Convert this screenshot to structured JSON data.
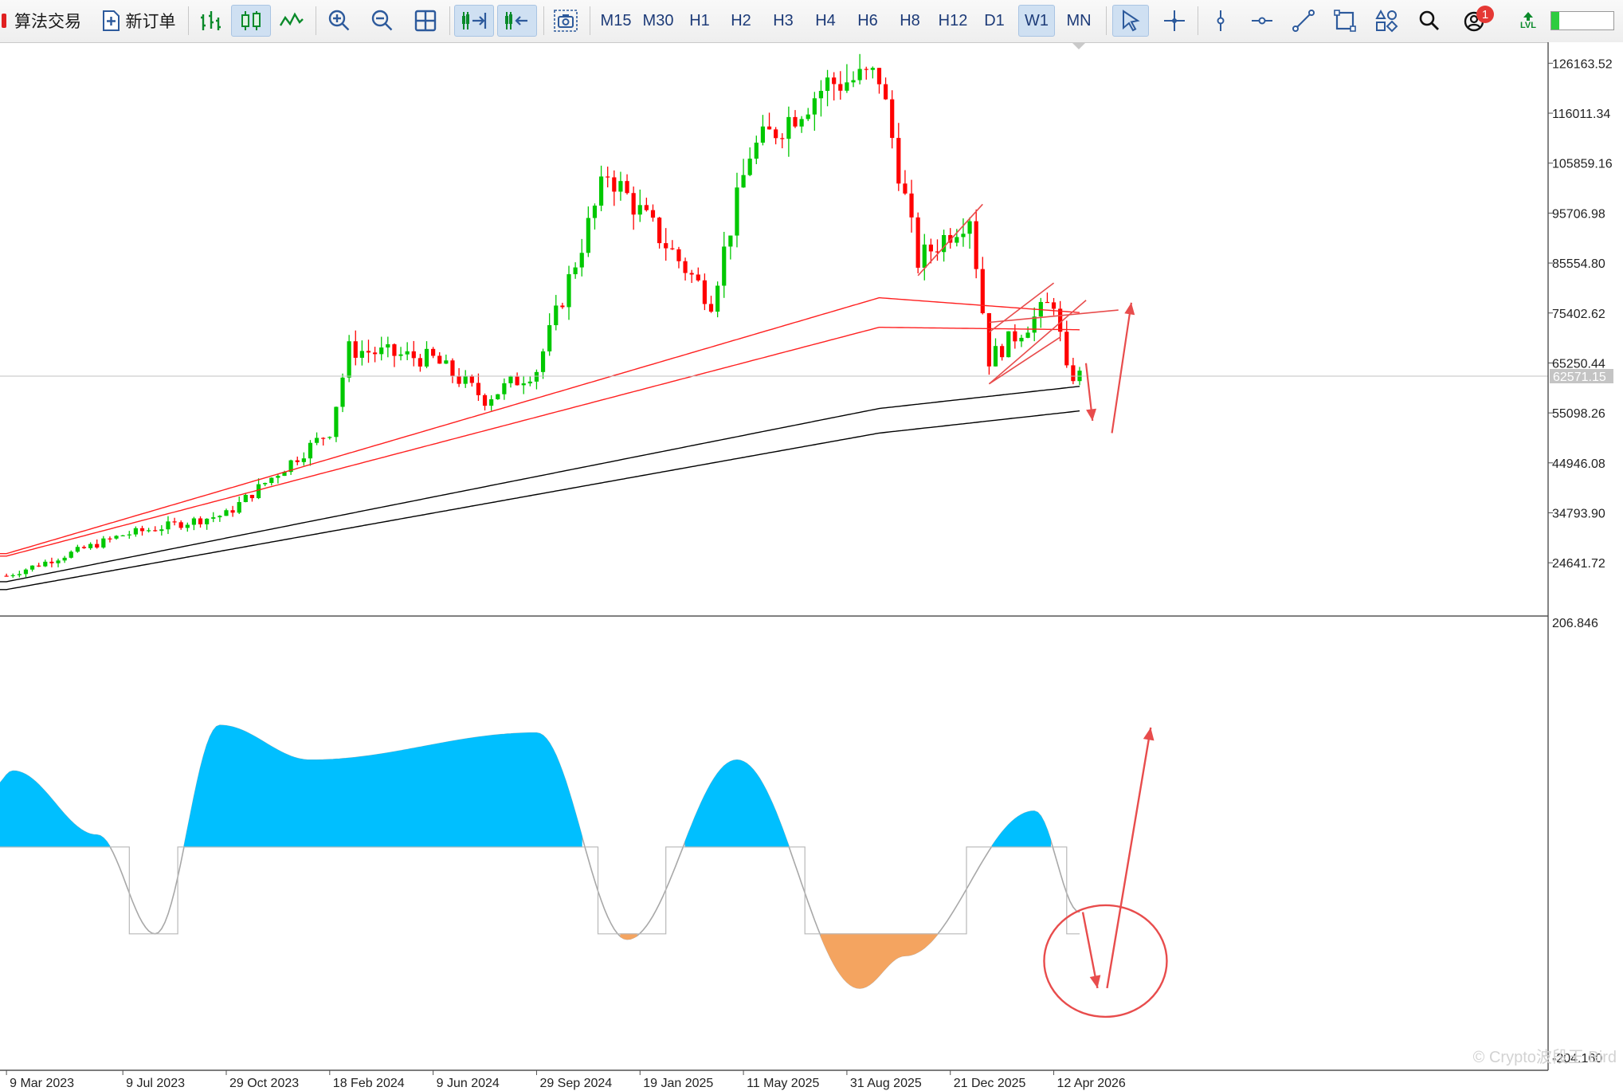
{
  "toolbar": {
    "algo_trading": "算法交易",
    "new_order": "新订单",
    "timeframes": [
      "M15",
      "M30",
      "H1",
      "H2",
      "H3",
      "H4",
      "H6",
      "H8",
      "H12",
      "D1",
      "W1",
      "MN"
    ],
    "active_timeframe": "W1",
    "notification_count": "1",
    "lvl_label": "LVL"
  },
  "price_panel": {
    "current_price": "62571.15",
    "y_ticks": [
      "126163.52",
      "116011.34",
      "105859.16",
      "95706.98",
      "85554.80",
      "75402.62",
      "65250.44",
      "55098.26",
      "44946.08",
      "34793.90",
      "24641.72"
    ]
  },
  "oscillator_panel": {
    "max_label": "206.846",
    "min_label": "-204.160"
  },
  "x_ticks": [
    "9 Mar 2023",
    "9 Jul 2023",
    "29 Oct 2023",
    "18 Feb 2024",
    "9 Jun 2024",
    "29 Sep 2024",
    "19 Jan 2025",
    "11 May 2025",
    "31 Aug 2025",
    "21 Dec 2025",
    "12 Apr 2026"
  ],
  "watermark": "© Crypto波段王 Bird",
  "colors": {
    "bull": "#00c800",
    "bear": "#ff0000",
    "ma_red": "#ff2020",
    "ma_black": "#000000",
    "osc_pos": "#00bfff",
    "osc_neg": "#f4a460",
    "annotation": "#e84c4c"
  },
  "chart_data": [
    {
      "type": "candlestick",
      "title": "",
      "timeframe": "W1",
      "x_range": [
        "2023-02-27",
        "2026-05-11"
      ],
      "y_range": [
        19000,
        128000
      ],
      "key_points": [
        {
          "date": "2023-03-06",
          "close": 22000
        },
        {
          "date": "2023-07-10",
          "close": 30300
        },
        {
          "date": "2023-10-30",
          "close": 34500
        },
        {
          "date": "2024-02-19",
          "close": 51500
        },
        {
          "date": "2024-03-11",
          "close": 68000
        },
        {
          "date": "2024-06-10",
          "close": 66000
        },
        {
          "date": "2024-08-05",
          "close": 58000
        },
        {
          "date": "2024-09-30",
          "close": 64000
        },
        {
          "date": "2024-12-16",
          "close": 104000
        },
        {
          "date": "2025-04-07",
          "close": 78000
        },
        {
          "date": "2025-05-19",
          "close": 108000
        },
        {
          "date": "2025-08-11",
          "close": 122000
        },
        {
          "date": "2025-10-06",
          "close": 123500
        },
        {
          "date": "2025-11-17",
          "close": 86000
        },
        {
          "date": "2026-01-12",
          "close": 95500
        },
        {
          "date": "2026-02-02",
          "close": 66000
        },
        {
          "date": "2026-04-13",
          "close": 78000
        },
        {
          "date": "2026-04-27",
          "close": 63000
        },
        {
          "date": "2026-05-11",
          "close": 62571.15
        }
      ],
      "moving_averages": [
        {
          "color": "red",
          "values_at": [
            {
              "date": "2023-03-06",
              "value": 26500
            },
            {
              "date": "2025-10-06",
              "value": 78500
            },
            {
              "date": "2026-05-11",
              "value": 75500
            }
          ]
        },
        {
          "color": "red",
          "values_at": [
            {
              "date": "2023-03-06",
              "value": 26000
            },
            {
              "date": "2025-10-06",
              "value": 72500
            },
            {
              "date": "2026-05-11",
              "value": 72000
            }
          ]
        },
        {
          "color": "black",
          "values_at": [
            {
              "date": "2023-03-06",
              "value": 20800
            },
            {
              "date": "2025-10-06",
              "value": 56000
            },
            {
              "date": "2026-05-11",
              "value": 60500
            }
          ]
        },
        {
          "color": "black",
          "values_at": [
            {
              "date": "2023-03-06",
              "value": 19200
            },
            {
              "date": "2025-10-06",
              "value": 51000
            },
            {
              "date": "2026-05-11",
              "value": 55500
            }
          ]
        }
      ]
    },
    {
      "type": "area",
      "title": "",
      "y_range": [
        -204.16,
        206.846
      ],
      "zero_level": 0,
      "positive_peaks": [
        {
          "date": "2023-03-13",
          "value": 70
        },
        {
          "date": "2023-06-12",
          "value": 11
        },
        {
          "date": "2023-10-23",
          "value": 112
        },
        {
          "date": "2024-01-29",
          "value": 80
        },
        {
          "date": "2024-09-30",
          "value": 105
        },
        {
          "date": "2025-05-05",
          "value": 80
        },
        {
          "date": "2026-03-23",
          "value": 33
        }
      ],
      "negative_troughs": [
        {
          "date": "2023-08-14",
          "value": -80
        },
        {
          "date": "2025-01-06",
          "value": -85
        },
        {
          "date": "2025-09-15",
          "value": -130
        },
        {
          "date": "2025-11-03",
          "value": -100
        }
      ]
    }
  ]
}
